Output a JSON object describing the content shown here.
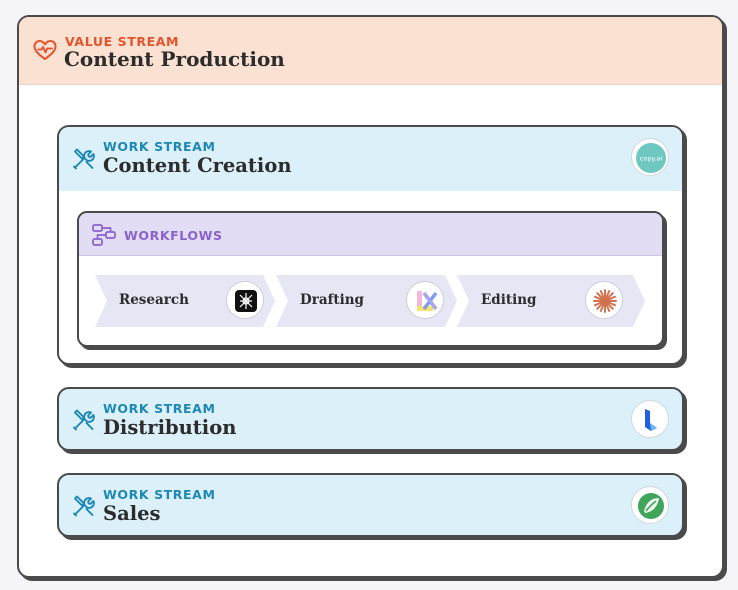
{
  "value_stream": {
    "eyebrow": "VALUE STREAM",
    "title": "Content Production",
    "icon": "heart-pulse-icon",
    "color": "#e2542b",
    "header_bg": "#fbe1d2"
  },
  "work_streams": [
    {
      "eyebrow": "WORK STREAM",
      "title": "Content Creation",
      "icon": "tools-icon",
      "logo": "copy-ai-logo",
      "logo_text": "copy.ai",
      "color": "#1b88b5",
      "workflows": {
        "eyebrow": "WORKFLOWS",
        "icon": "workflow-icon",
        "color": "#8a62c9",
        "steps": [
          {
            "label": "Research",
            "logo": "research-app-logo"
          },
          {
            "label": "Drafting",
            "logo": "drafting-app-logo"
          },
          {
            "label": "Editing",
            "logo": "editing-app-logo"
          }
        ]
      }
    },
    {
      "eyebrow": "WORK STREAM",
      "title": "Distribution",
      "icon": "tools-icon",
      "logo": "distribution-app-logo"
    },
    {
      "eyebrow": "WORK STREAM",
      "title": "Sales",
      "icon": "tools-icon",
      "logo": "sales-app-logo"
    }
  ]
}
